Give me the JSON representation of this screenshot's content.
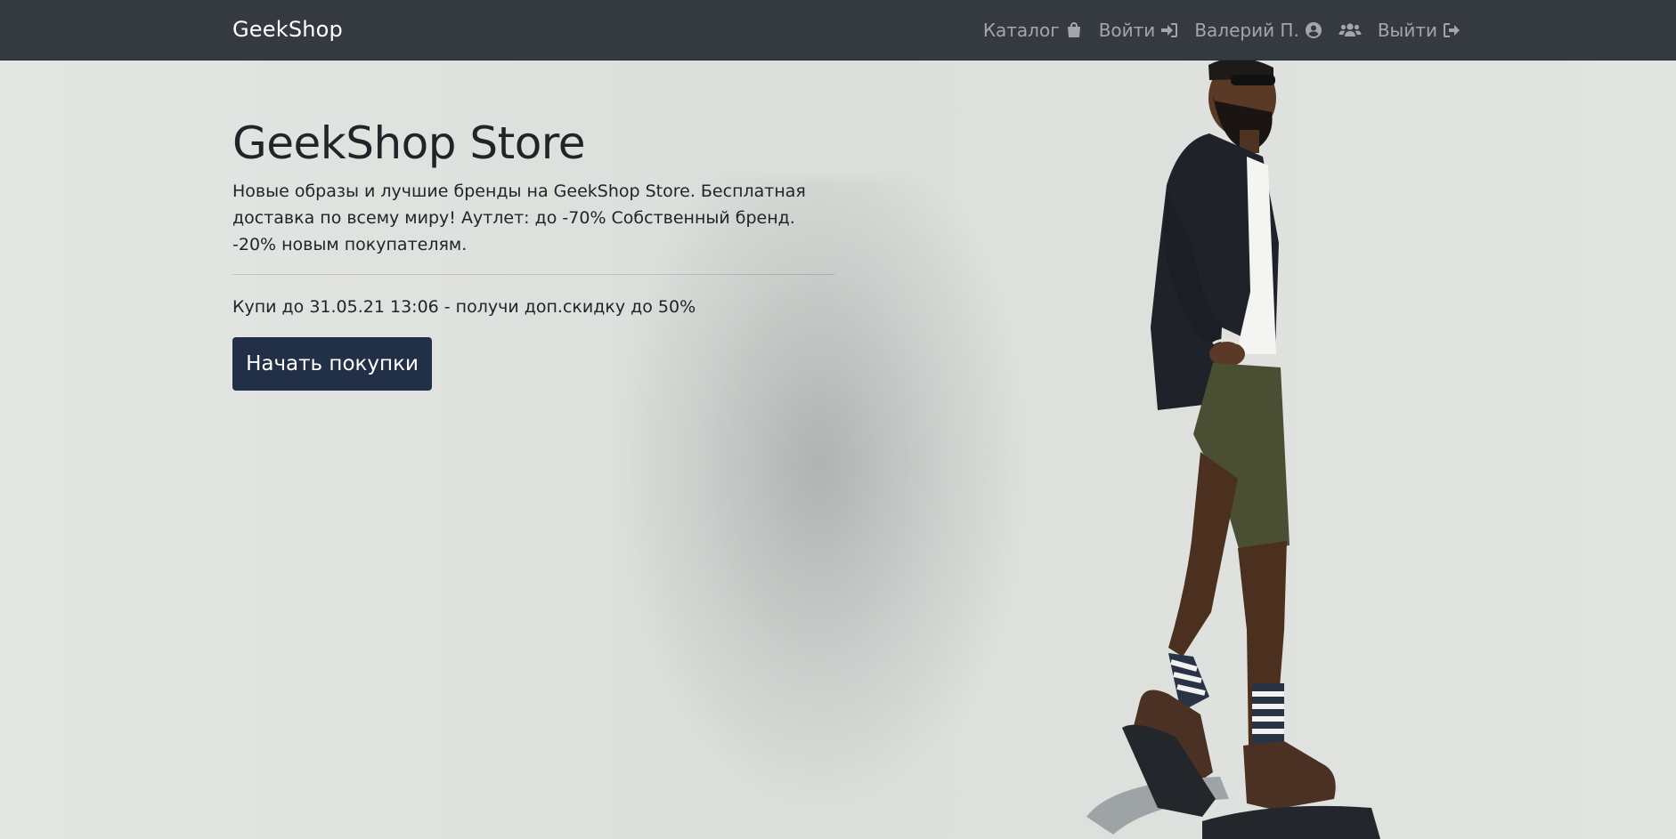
{
  "navbar": {
    "brand": "GeekShop",
    "links": [
      {
        "label": "Каталог",
        "icon": "shopping-bag-icon"
      },
      {
        "label": "Войти",
        "icon": "sign-in-icon"
      },
      {
        "label": "Валерий П.",
        "icon": "user-circle-icon"
      },
      {
        "label": "",
        "icon": "users-icon"
      },
      {
        "label": "Выйти",
        "icon": "sign-out-icon"
      }
    ],
    "background": "#343a40"
  },
  "hero": {
    "title": "GeekShop Store",
    "lead": "Новые образы и лучшие бренды на GeekShop Store. Бесплатная доставка по всему миру! Аутлет: до -70% Собственный бренд. -20% новым покупателям.",
    "promo": "Купи до 31.05.21 13:06 - получи доп.скидку до 50%",
    "cta_label": "Начать покупки",
    "cta_color": "#223047"
  }
}
